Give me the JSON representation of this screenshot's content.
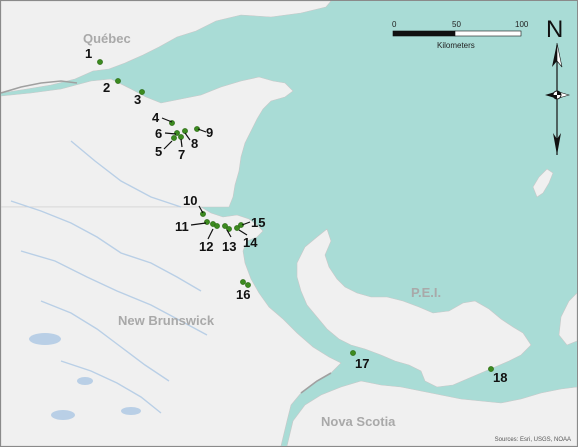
{
  "map": {
    "regions": {
      "quebec": "Québec",
      "new_brunswick": "New Brunswick",
      "pei": "P.E.I.",
      "nova_scotia": "Nova Scotia"
    },
    "colors": {
      "water": "#a9dcd6",
      "land": "#f0f0f0",
      "rivers": "#b9cfe6",
      "boundary": "#a0a0a0",
      "site_marker": "#3c8a1f"
    },
    "sites": [
      {
        "id": "1",
        "label": "1"
      },
      {
        "id": "2",
        "label": "2"
      },
      {
        "id": "3",
        "label": "3"
      },
      {
        "id": "4",
        "label": "4"
      },
      {
        "id": "5",
        "label": "5"
      },
      {
        "id": "6",
        "label": "6"
      },
      {
        "id": "7",
        "label": "7"
      },
      {
        "id": "8",
        "label": "8"
      },
      {
        "id": "9",
        "label": "9"
      },
      {
        "id": "10",
        "label": "10"
      },
      {
        "id": "11",
        "label": "11"
      },
      {
        "id": "12",
        "label": "12"
      },
      {
        "id": "13",
        "label": "13"
      },
      {
        "id": "14",
        "label": "14"
      },
      {
        "id": "15",
        "label": "15"
      },
      {
        "id": "16",
        "label": "16"
      },
      {
        "id": "17",
        "label": "17"
      },
      {
        "id": "18",
        "label": "18"
      }
    ],
    "scale_bar": {
      "ticks": [
        "0",
        "50",
        "100"
      ],
      "unit": "Kilometers"
    },
    "north_arrow": {
      "label": "N",
      "icon": "north-arrow-icon"
    },
    "sources": "Sources: Esri, USGS, NOAA"
  }
}
